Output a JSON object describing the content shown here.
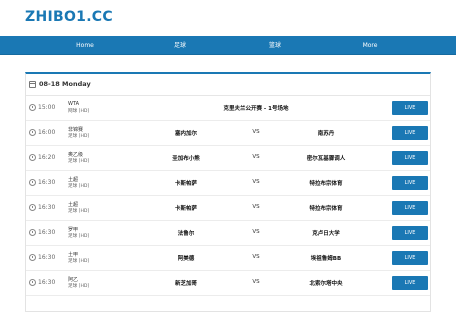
{
  "site": {
    "logo": "ZHIBO1.CC"
  },
  "nav": {
    "items": [
      "Home",
      "足球",
      "篮球",
      "More"
    ]
  },
  "schedule": {
    "date_label": "08-18  Monday",
    "matches": [
      {
        "time": "15:00",
        "league": "WTA",
        "subtype": "网球 [HD]",
        "title": "克里夫兰公开赛 - 1号场地",
        "live_label": "LIVE"
      },
      {
        "time": "16:00",
        "league": "非锦赛",
        "subtype": "足球 [HD]",
        "home": "塞内加尔",
        "vs": "VS",
        "away": "南苏丹",
        "live_label": "LIVE"
      },
      {
        "time": "16:20",
        "league": "奥乙级",
        "subtype": "足球 [HD]",
        "home": "圣加布小熊",
        "vs": "VS",
        "away": "密尔瓦基骤调人",
        "live_label": "LIVE"
      },
      {
        "time": "16:30",
        "league": "土超",
        "subtype": "足球 [HD]",
        "home": "卡斯帕萨",
        "vs": "VS",
        "away": "特拉布宗体育",
        "live_label": "LIVE"
      },
      {
        "time": "16:30",
        "league": "土超",
        "subtype": "足球 [HD]",
        "home": "卡斯帕萨",
        "vs": "VS",
        "away": "特拉布宗体育",
        "live_label": "LIVE"
      },
      {
        "time": "16:30",
        "league": "罗甲",
        "subtype": "足球 [HD]",
        "home": "法鲁尔",
        "vs": "VS",
        "away": "克卢日大学",
        "live_label": "LIVE"
      },
      {
        "time": "16:30",
        "league": "土甲",
        "subtype": "足球 [HD]",
        "home": "阿美德",
        "vs": "VS",
        "away": "埃祖鲁姆BB",
        "live_label": "LIVE"
      },
      {
        "time": "16:30",
        "league": "阿乙",
        "subtype": "足球 [HD]",
        "home": "新芝加哥",
        "vs": "VS",
        "away": "北索尔塔中央",
        "live_label": "LIVE"
      }
    ]
  },
  "colors": {
    "brand": "#1a78b4",
    "text": "#333333"
  }
}
